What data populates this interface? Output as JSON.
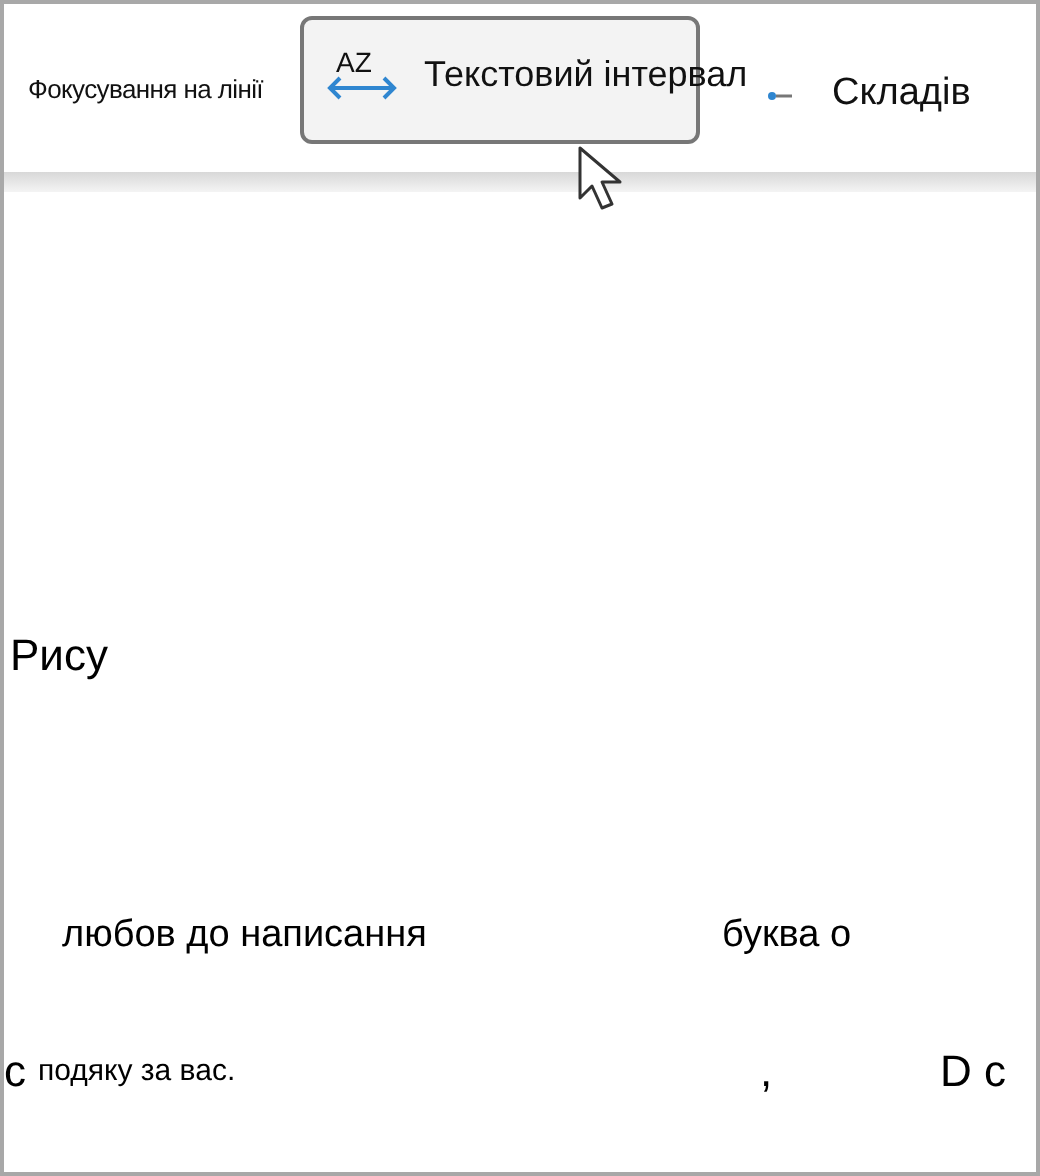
{
  "toolbar": {
    "line_focus": "Фокусування на лінії",
    "popup": {
      "icon_label": "AZ",
      "label": "Текстовий інтервал"
    },
    "syllables": "Складів"
  },
  "document": {
    "fragments": [
      {
        "kind": "large",
        "text": "Рису"
      },
      {
        "kind": "medium",
        "text": "любов до написання"
      },
      {
        "kind": "medium",
        "text": "буква о"
      },
      {
        "kind": "large",
        "text": "с"
      },
      {
        "kind": "small",
        "text": "подяку за вас."
      },
      {
        "kind": "large",
        "text": ","
      },
      {
        "kind": "large",
        "text": "D с"
      }
    ]
  }
}
